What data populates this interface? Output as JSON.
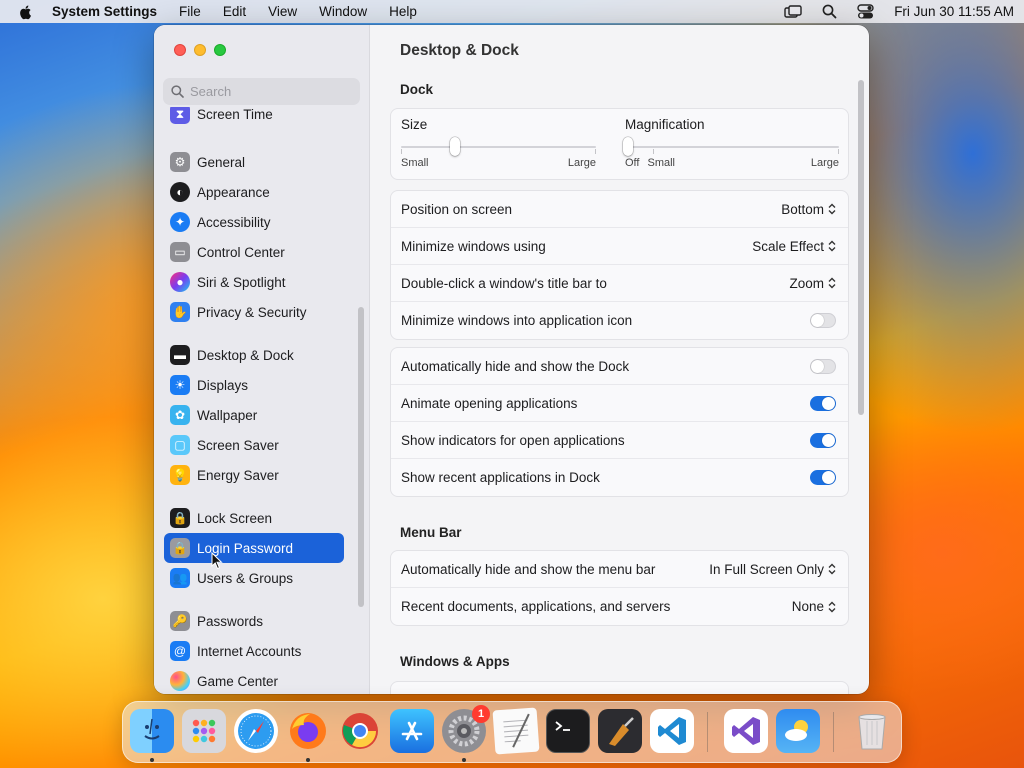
{
  "menubar": {
    "app_name": "System Settings",
    "menus": [
      "File",
      "Edit",
      "View",
      "Window",
      "Help"
    ],
    "clock": "Fri Jun 30  11:55 AM"
  },
  "sidebar": {
    "search_placeholder": "Search",
    "items": [
      {
        "label": "Screen Time",
        "icon": "hourglass-icon",
        "color": "#5e5ce6"
      },
      {
        "label": "General",
        "icon": "gear-icon",
        "color": "#8e8e93"
      },
      {
        "label": "Appearance",
        "icon": "appearance-icon",
        "color": "#1d1d1f"
      },
      {
        "label": "Accessibility",
        "icon": "accessibility-icon",
        "color": "#1a7cf4"
      },
      {
        "label": "Control Center",
        "icon": "control-center-icon",
        "color": "#8e8e93"
      },
      {
        "label": "Siri & Spotlight",
        "icon": "siri-icon",
        "color": "#b53ad6"
      },
      {
        "label": "Privacy & Security",
        "icon": "hand-icon",
        "color": "#2f80f0"
      },
      {
        "label": "Desktop & Dock",
        "icon": "desktop-dock-icon",
        "color": "#1d1d1f"
      },
      {
        "label": "Displays",
        "icon": "displays-icon",
        "color": "#1a7cf4"
      },
      {
        "label": "Wallpaper",
        "icon": "wallpaper-icon",
        "color": "#38b3ef"
      },
      {
        "label": "Screen Saver",
        "icon": "screen-saver-icon",
        "color": "#5ac8fa"
      },
      {
        "label": "Energy Saver",
        "icon": "bulb-icon",
        "color": "#ffb30f"
      },
      {
        "label": "Lock Screen",
        "icon": "lock-icon",
        "color": "#1d1d1f"
      },
      {
        "label": "Login Password",
        "icon": "login-password-icon",
        "color": "#8e8e93"
      },
      {
        "label": "Users & Groups",
        "icon": "users-icon",
        "color": "#1a7cf4"
      },
      {
        "label": "Passwords",
        "icon": "key-icon",
        "color": "#8e8e93"
      },
      {
        "label": "Internet Accounts",
        "icon": "at-icon",
        "color": "#1a7cf4"
      },
      {
        "label": "Game Center",
        "icon": "game-center-icon",
        "color": "#ffffff"
      }
    ],
    "selected": "Login Password"
  },
  "main": {
    "title": "Desktop & Dock",
    "dock_section": "Dock",
    "size_slider": {
      "title": "Size",
      "min_label": "Small",
      "max_label": "Large",
      "value": 0.28
    },
    "magnification_slider": {
      "title": "Magnification",
      "off_label": "Off",
      "min_label": "Small",
      "max_label": "Large",
      "value": 0.0
    },
    "dock_rows": [
      {
        "label": "Position on screen",
        "value": "Bottom"
      },
      {
        "label": "Minimize windows using",
        "value": "Scale Effect"
      },
      {
        "label": "Double-click a window's title bar to",
        "value": "Zoom"
      },
      {
        "label": "Minimize windows into application icon",
        "toggle": false
      }
    ],
    "dock_toggles": [
      {
        "label": "Automatically hide and show the Dock",
        "toggle": false
      },
      {
        "label": "Animate opening applications",
        "toggle": true
      },
      {
        "label": "Show indicators for open applications",
        "toggle": true
      },
      {
        "label": "Show recent applications in Dock",
        "toggle": true
      }
    ],
    "menu_bar_section": "Menu Bar",
    "menu_bar_rows": [
      {
        "label": "Automatically hide and show the menu bar",
        "value": "In Full Screen Only"
      },
      {
        "label": "Recent documents, applications, and servers",
        "value": "None"
      }
    ],
    "windows_apps_section": "Windows & Apps"
  },
  "dock": {
    "apps": [
      "Finder",
      "Launchpad",
      "Safari",
      "Firefox",
      "Chrome",
      "App Store",
      "System Settings",
      "TextEdit",
      "Terminal",
      "Instruments",
      "Visual Studio Code",
      "Visual Studio",
      "Weather",
      "Trash"
    ],
    "settings_badge": "1"
  },
  "colors": {
    "accent": "#1b62d9",
    "toggle_on": "#1a6fe0"
  }
}
